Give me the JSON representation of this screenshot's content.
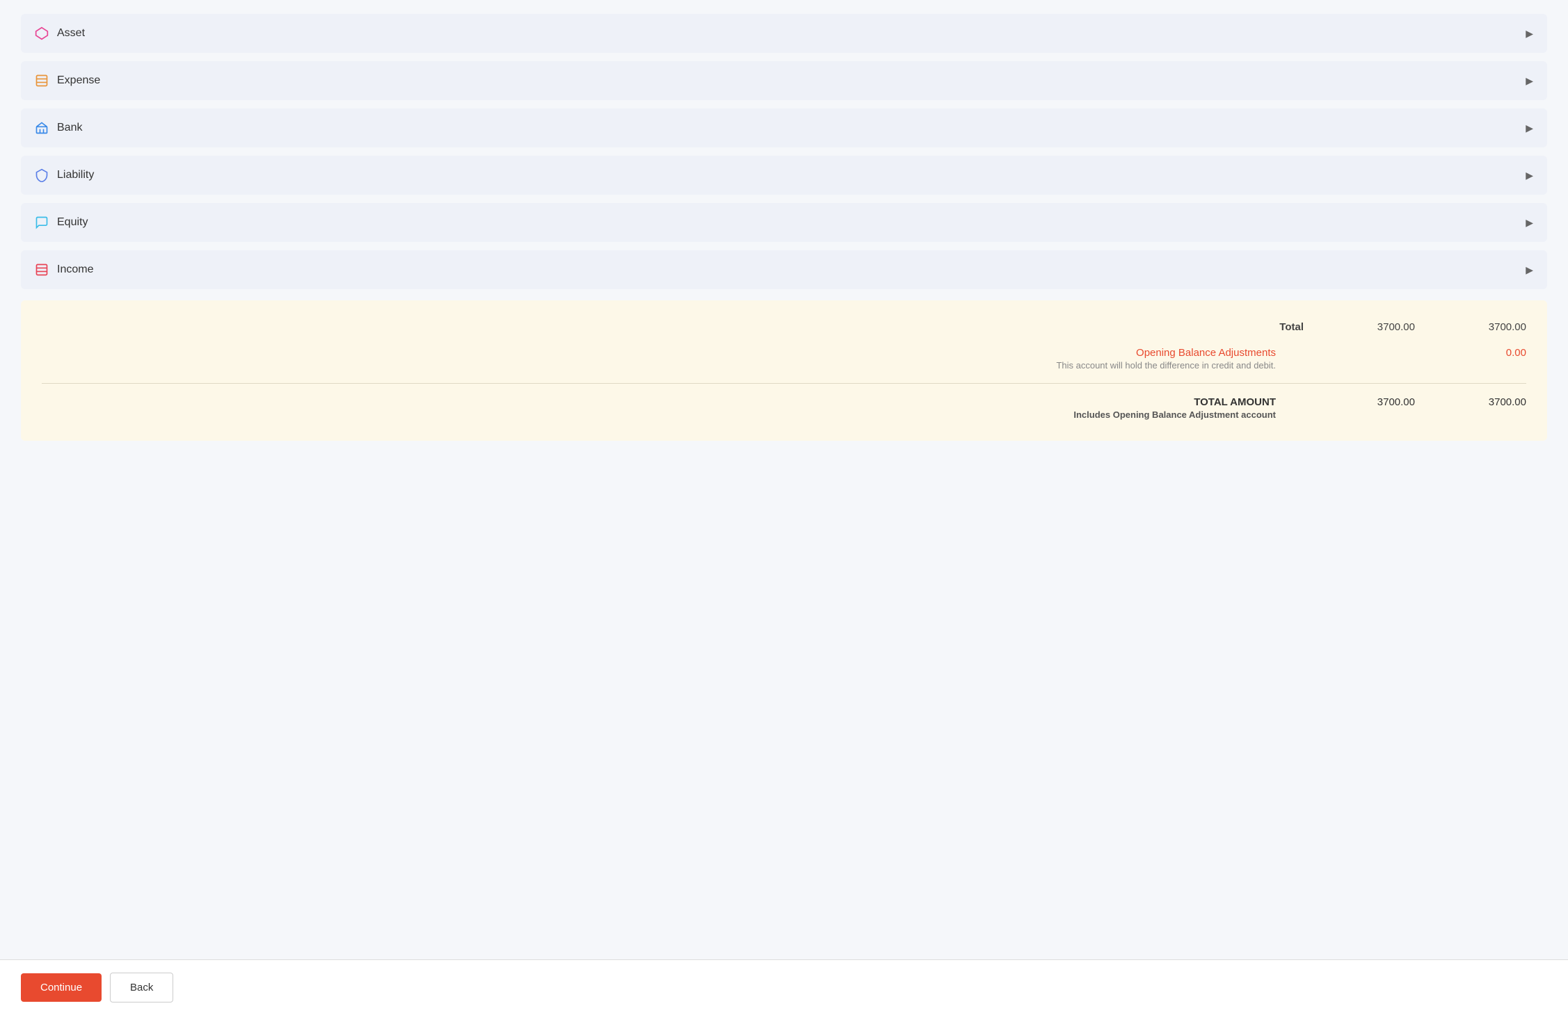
{
  "accounts": [
    {
      "id": "asset",
      "label": "Asset",
      "icon": "asset",
      "icon_symbol": "◇"
    },
    {
      "id": "expense",
      "label": "Expense",
      "icon": "expense",
      "icon_symbol": "▤"
    },
    {
      "id": "bank",
      "label": "Bank",
      "icon": "bank",
      "icon_symbol": "⊞"
    },
    {
      "id": "liability",
      "label": "Liability",
      "icon": "liability",
      "icon_symbol": "⬡"
    },
    {
      "id": "equity",
      "label": "Equity",
      "icon": "equity",
      "icon_symbol": "◯"
    },
    {
      "id": "income",
      "label": "Income",
      "icon": "income",
      "icon_symbol": "▤"
    }
  ],
  "summary": {
    "total_label": "Total",
    "total_debit": "3700.00",
    "total_credit": "3700.00",
    "opening_balance_label": "Opening Balance Adjustments",
    "opening_balance_subtitle": "This account will hold the difference in credit and debit.",
    "opening_balance_amount": "0.00",
    "total_amount_label": "TOTAL AMOUNT",
    "total_amount_sublabel": "Includes Opening Balance Adjustment account",
    "total_amount_debit": "3700.00",
    "total_amount_credit": "3700.00"
  },
  "footer": {
    "continue_label": "Continue",
    "back_label": "Back"
  }
}
